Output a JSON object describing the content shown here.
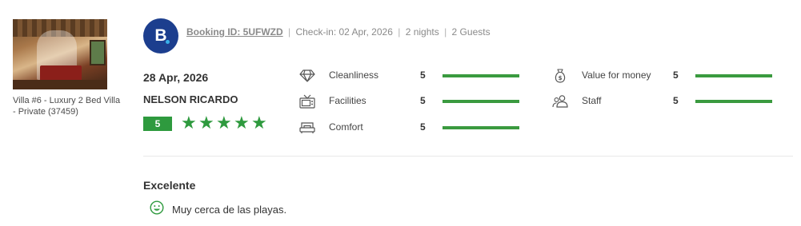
{
  "property": {
    "name": "Villa #6 - Luxury 2 Bed Villa - Private (37459)"
  },
  "source": {
    "logo_letter": "B",
    "logo_color": "#1c3e8e"
  },
  "booking": {
    "id_label": "Booking ID: 5UFWZD",
    "checkin": "Check-in: 02 Apr, 2026",
    "nights": "2 nights",
    "guests": "2 Guests",
    "separator": "|"
  },
  "review": {
    "date": "28 Apr, 2026",
    "reviewer": "NELSON RICARDO",
    "overall_score": "5",
    "stars": 5,
    "headline": "Excelente",
    "positive": "Muy cerca de las playas."
  },
  "ratings": [
    {
      "label": "Cleanliness",
      "score": "5",
      "fraction": 1.0,
      "icon": "diamond-icon"
    },
    {
      "label": "Facilities",
      "score": "5",
      "fraction": 1.0,
      "icon": "tv-icon"
    },
    {
      "label": "Comfort",
      "score": "5",
      "fraction": 1.0,
      "icon": "bed-icon"
    },
    {
      "label": "Value for money",
      "score": "5",
      "fraction": 1.0,
      "icon": "money-bag-icon"
    },
    {
      "label": "Staff",
      "score": "5",
      "fraction": 1.0,
      "icon": "people-icon"
    }
  ],
  "colors": {
    "accent_green": "#2e9a3e",
    "bar_green": "#3a9a3f",
    "muted_text": "#8a8a8a"
  }
}
